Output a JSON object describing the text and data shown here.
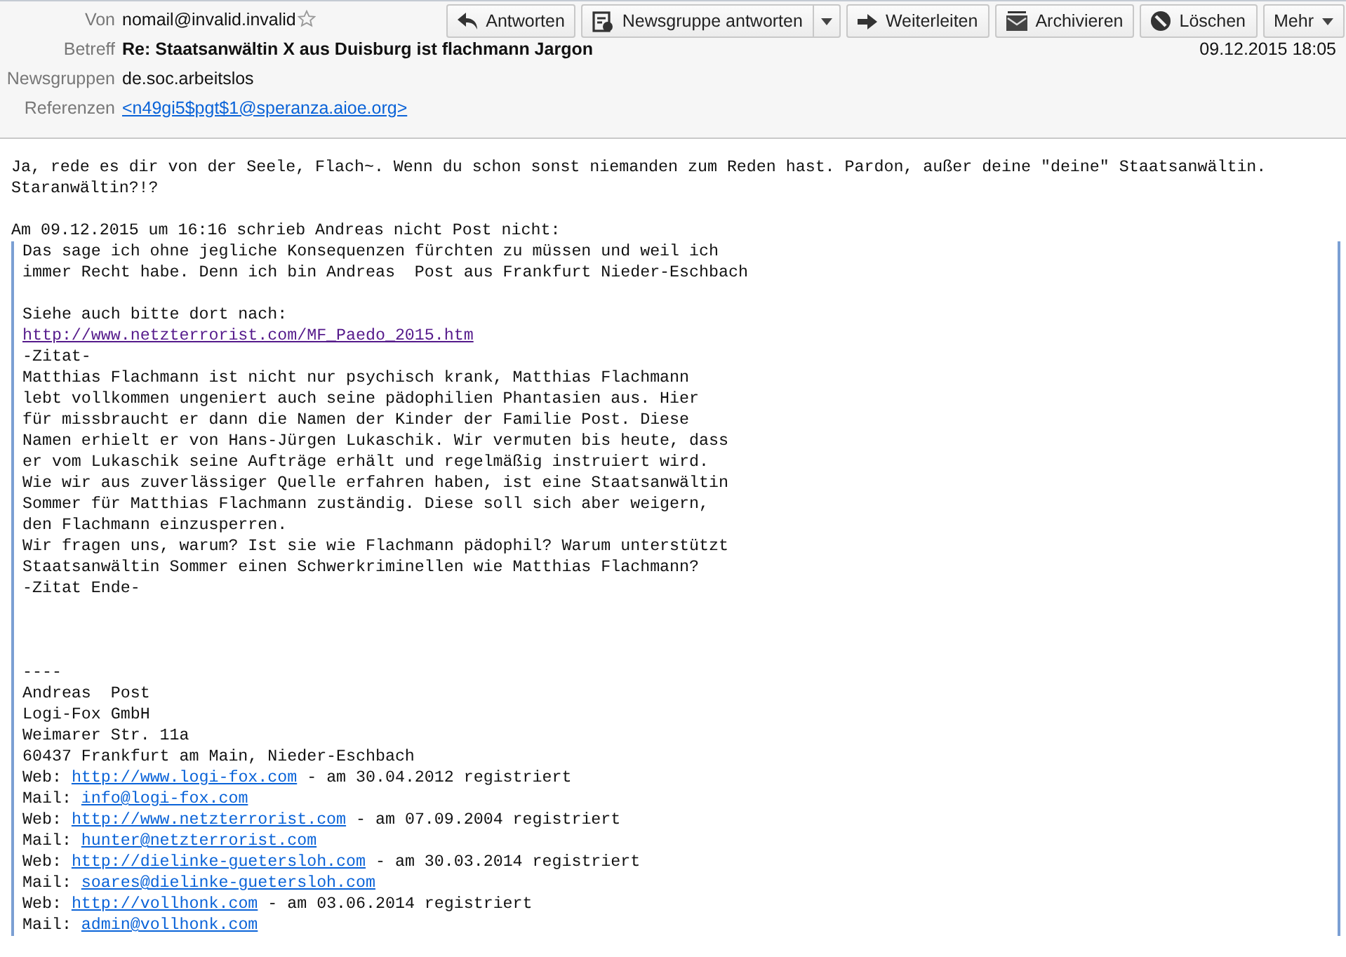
{
  "header": {
    "fields": [
      {
        "label": "Von",
        "value": "nomail@invalid.invalid",
        "kind": "sender"
      },
      {
        "label": "Betreff",
        "value": "Re: Staatsanwältin X aus Duisburg ist flachmann Jargon",
        "kind": "subject"
      },
      {
        "label": "Newsgruppen",
        "value": "de.soc.arbeitslos",
        "kind": "plain"
      },
      {
        "label": "Referenzen",
        "value": "<n49gi5$pgt$1@speranza.aioe.org>",
        "kind": "link"
      }
    ],
    "starred": false,
    "date": "09.12.2015 18:05",
    "buttons": [
      {
        "label": "Antworten",
        "kind": "plain"
      },
      {
        "label": "Newsgruppe antworten",
        "kind": "split"
      },
      {
        "label": "Weiterleiten",
        "kind": "plain"
      },
      {
        "label": "Archivieren",
        "kind": "plain"
      },
      {
        "label": "Löschen",
        "kind": "plain"
      },
      {
        "label": "Mehr",
        "kind": "menu"
      }
    ]
  },
  "body": {
    "intro": "Ja, rede es dir von der Seele, Flach~. Wenn du schon sonst niemanden zum Reden hast. Pardon, außer deine \"deine\" Staatsanwältin. Staranwältin?!?",
    "attribution": "Am 09.12.2015 um 16:16 schrieb Andreas nicht Post nicht:",
    "quote": [
      {
        "kind": "text",
        "parts": [
          {
            "text": "Das sage ich ohne jegliche Konsequenzen fürchten zu müssen und weil ich",
            "link": false
          }
        ]
      },
      {
        "kind": "text",
        "parts": [
          {
            "text": "immer Recht habe. Denn ich bin Andreas  Post aus Frankfurt Nieder-Eschbach",
            "link": false
          }
        ]
      },
      {
        "kind": "blank"
      },
      {
        "kind": "text",
        "parts": [
          {
            "text": "Siehe auch bitte dort nach:",
            "link": false
          }
        ]
      },
      {
        "kind": "text",
        "parts": [
          {
            "text": "http://www.netzterrorist.com/MF_Paedo_2015.htm",
            "link": true,
            "visited": true
          }
        ]
      },
      {
        "kind": "text",
        "parts": [
          {
            "text": "-Zitat-",
            "link": false
          }
        ]
      },
      {
        "kind": "text",
        "parts": [
          {
            "text": "Matthias Flachmann ist nicht nur psychisch krank, Matthias Flachmann",
            "link": false
          }
        ]
      },
      {
        "kind": "text",
        "parts": [
          {
            "text": "lebt vollkommen ungeniert auch seine pädophilien Phantasien aus. Hier",
            "link": false
          }
        ]
      },
      {
        "kind": "text",
        "parts": [
          {
            "text": "für missbraucht er dann die Namen der Kinder der Familie Post. Diese",
            "link": false
          }
        ]
      },
      {
        "kind": "text",
        "parts": [
          {
            "text": "Namen erhielt er von Hans-Jürgen Lukaschik. Wir vermuten bis heute, dass",
            "link": false
          }
        ]
      },
      {
        "kind": "text",
        "parts": [
          {
            "text": "er vom Lukaschik seine Aufträge erhält und regelmäßig instruiert wird.",
            "link": false
          }
        ]
      },
      {
        "kind": "text",
        "parts": [
          {
            "text": "Wie wir aus zuverlässiger Quelle erfahren haben, ist eine Staatsanwältin",
            "link": false
          }
        ]
      },
      {
        "kind": "text",
        "parts": [
          {
            "text": "Sommer für Matthias Flachmann zuständig. Diese soll sich aber weigern,",
            "link": false
          }
        ]
      },
      {
        "kind": "text",
        "parts": [
          {
            "text": "den Flachmann einzusperren.",
            "link": false
          }
        ]
      },
      {
        "kind": "text",
        "parts": [
          {
            "text": "Wir fragen uns, warum? Ist sie wie Flachmann pädophil? Warum unterstützt",
            "link": false
          }
        ]
      },
      {
        "kind": "text",
        "parts": [
          {
            "text": "Staatsanwältin Sommer einen Schwerkriminellen wie Matthias Flachmann?",
            "link": false
          }
        ]
      },
      {
        "kind": "text",
        "parts": [
          {
            "text": "-Zitat Ende-",
            "link": false
          }
        ]
      },
      {
        "kind": "blank"
      },
      {
        "kind": "blank"
      },
      {
        "kind": "blank"
      },
      {
        "kind": "text",
        "parts": [
          {
            "text": "----",
            "link": false
          }
        ]
      },
      {
        "kind": "text",
        "parts": [
          {
            "text": "Andreas  Post",
            "link": false
          }
        ]
      },
      {
        "kind": "text",
        "parts": [
          {
            "text": "Logi-Fox GmbH",
            "link": false
          }
        ]
      },
      {
        "kind": "text",
        "parts": [
          {
            "text": "Weimarer Str. 11a",
            "link": false
          }
        ]
      },
      {
        "kind": "text",
        "parts": [
          {
            "text": "60437 Frankfurt am Main, Nieder-Eschbach",
            "link": false
          }
        ]
      },
      {
        "kind": "text",
        "parts": [
          {
            "text": "Web: ",
            "link": false
          },
          {
            "text": "http://www.logi-fox.com",
            "link": true,
            "visited": false
          },
          {
            "text": " - am 30.04.2012 registriert",
            "link": false
          }
        ]
      },
      {
        "kind": "text",
        "parts": [
          {
            "text": "Mail: ",
            "link": false
          },
          {
            "text": "info@logi-fox.com",
            "link": true,
            "visited": false
          }
        ]
      },
      {
        "kind": "text",
        "parts": [
          {
            "text": "Web: ",
            "link": false
          },
          {
            "text": "http://www.netzterrorist.com",
            "link": true,
            "visited": false
          },
          {
            "text": " - am 07.09.2004 registriert",
            "link": false
          }
        ]
      },
      {
        "kind": "text",
        "parts": [
          {
            "text": "Mail: ",
            "link": false
          },
          {
            "text": "hunter@netzterrorist.com",
            "link": true,
            "visited": false
          }
        ]
      },
      {
        "kind": "text",
        "parts": [
          {
            "text": "Web: ",
            "link": false
          },
          {
            "text": "http://dielinke-guetersloh.com",
            "link": true,
            "visited": false
          },
          {
            "text": " - am 30.03.2014 registriert",
            "link": false
          }
        ]
      },
      {
        "kind": "text",
        "parts": [
          {
            "text": "Mail: ",
            "link": false
          },
          {
            "text": "soares@dielinke-guetersloh.com",
            "link": true,
            "visited": false
          }
        ]
      },
      {
        "kind": "text",
        "parts": [
          {
            "text": "Web: ",
            "link": false
          },
          {
            "text": "http://vollhonk.com",
            "link": true,
            "visited": false
          },
          {
            "text": " - am 03.06.2014 registriert",
            "link": false
          }
        ]
      },
      {
        "kind": "text",
        "parts": [
          {
            "text": "Mail: ",
            "link": false
          },
          {
            "text": "admin@vollhonk.com",
            "link": true,
            "visited": false
          }
        ]
      }
    ]
  }
}
